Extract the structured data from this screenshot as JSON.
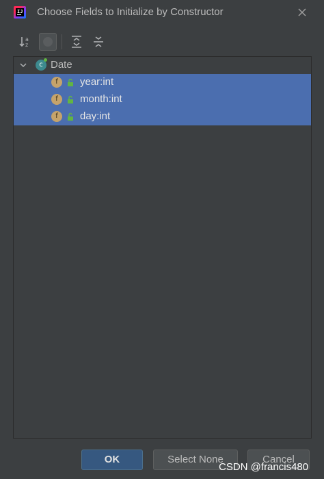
{
  "window": {
    "title": "Choose Fields to Initialize by Constructor",
    "app_icon_text": "IJ"
  },
  "toolbar": {
    "buttons": [
      {
        "icon": "sort-alphabetically-icon",
        "active": false
      },
      {
        "icon": "show-classes-icon",
        "active": true
      },
      {
        "icon": "expand-all-icon",
        "active": false
      },
      {
        "icon": "collapse-all-icon",
        "active": false
      }
    ]
  },
  "tree": {
    "root": {
      "icon_letter": "c",
      "label": "Date",
      "expanded": true
    },
    "fields": [
      {
        "icon_letter": "f",
        "label": "year:int",
        "selected": true
      },
      {
        "icon_letter": "f",
        "label": "month:int",
        "selected": true
      },
      {
        "icon_letter": "f",
        "label": "day:int",
        "selected": true
      }
    ]
  },
  "buttons": {
    "ok": "OK",
    "select_none": "Select None",
    "cancel": "Cancel"
  },
  "watermark": "CSDN @francis480",
  "colors": {
    "background": "#3c3f41",
    "selection": "#4b6eaf",
    "primary_button": "#365880",
    "field_icon": "#c5a36b",
    "class_icon": "#3d8a8f"
  }
}
